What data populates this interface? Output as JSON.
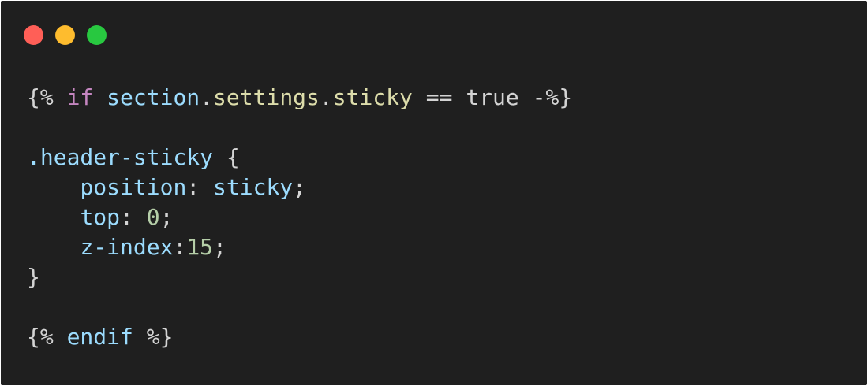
{
  "window": {
    "buttons": [
      {
        "name": "close",
        "color": "#ff5f57"
      },
      {
        "name": "minimize",
        "color": "#febc2e"
      },
      {
        "name": "zoom",
        "color": "#28c840"
      }
    ]
  },
  "colors": {
    "background": "#1f1f1f",
    "default": "#d4d4d4",
    "keyword": "#c586c0",
    "variable": "#9cdcfe",
    "function": "#dcdcaa",
    "number": "#b5cea8"
  },
  "code_lines": [
    [
      {
        "text": "{% ",
        "kind": "default"
      },
      {
        "text": "if",
        "kind": "keyword"
      },
      {
        "text": " ",
        "kind": "default"
      },
      {
        "text": "section",
        "kind": "variable"
      },
      {
        "text": ".",
        "kind": "default"
      },
      {
        "text": "settings",
        "kind": "function"
      },
      {
        "text": ".",
        "kind": "default"
      },
      {
        "text": "sticky",
        "kind": "function"
      },
      {
        "text": " == true -%}",
        "kind": "default"
      }
    ],
    [],
    [
      {
        "text": ".header-sticky",
        "kind": "variable"
      },
      {
        "text": " {",
        "kind": "default"
      }
    ],
    [
      {
        "text": "    ",
        "kind": "default"
      },
      {
        "text": "position",
        "kind": "variable"
      },
      {
        "text": ": ",
        "kind": "default"
      },
      {
        "text": "sticky",
        "kind": "variable"
      },
      {
        "text": ";",
        "kind": "default"
      }
    ],
    [
      {
        "text": "    ",
        "kind": "default"
      },
      {
        "text": "top",
        "kind": "variable"
      },
      {
        "text": ": ",
        "kind": "default"
      },
      {
        "text": "0",
        "kind": "number"
      },
      {
        "text": ";",
        "kind": "default"
      }
    ],
    [
      {
        "text": "    ",
        "kind": "default"
      },
      {
        "text": "z-index",
        "kind": "variable"
      },
      {
        "text": ":",
        "kind": "default"
      },
      {
        "text": "15",
        "kind": "number"
      },
      {
        "text": ";",
        "kind": "default"
      }
    ],
    [
      {
        "text": "}",
        "kind": "default"
      }
    ],
    [],
    [
      {
        "text": "{% ",
        "kind": "default"
      },
      {
        "text": "endif",
        "kind": "variable"
      },
      {
        "text": " %}",
        "kind": "default"
      }
    ]
  ]
}
